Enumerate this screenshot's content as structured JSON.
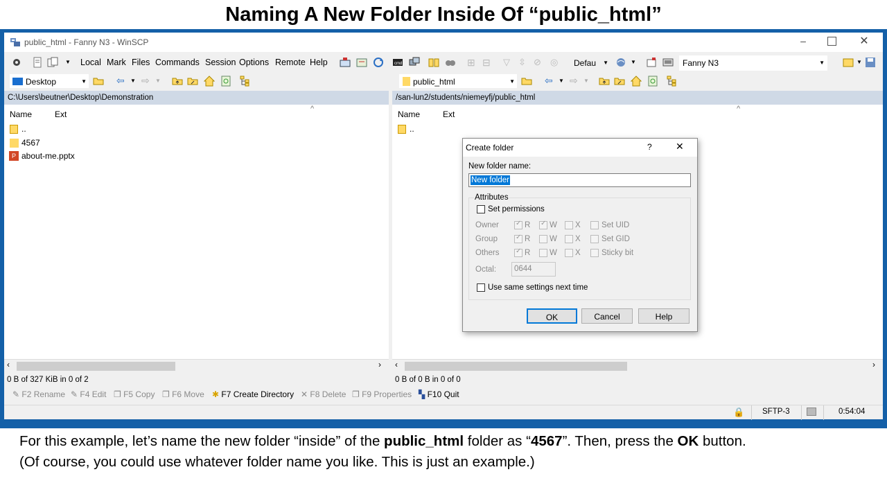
{
  "slide": {
    "title": "Naming A New Folder Inside Of “public_html”",
    "caption_1a": "For this example, let’s name the new folder “inside” of the ",
    "caption_1b": "public_html",
    "caption_1c": " folder as “",
    "caption_1d": "4567",
    "caption_1e": "”. Then, press the ",
    "caption_1f": "OK",
    "caption_1g": " button.",
    "caption_2": "(Of course, you could use whatever folder name you like. This is just an example.)"
  },
  "window": {
    "title": "public_html - Fanny N3 - WinSCP",
    "menu": [
      "Local",
      "Mark",
      "Files",
      "Commands",
      "Session",
      "Options",
      "Remote",
      "Help"
    ],
    "transfer_setting": "Defau",
    "session_name": "Fanny N3"
  },
  "left_panel": {
    "drive": "Desktop",
    "path": "C:\\Users\\beutner\\Desktop\\Demonstration",
    "col_name": "Name",
    "col_ext": "Ext",
    "files": [
      {
        "name": "..",
        "icon": "parent-folder-icon"
      },
      {
        "name": "4567",
        "icon": "folder-icon"
      },
      {
        "name": "about-me.pptx",
        "icon": "powerpoint-file-icon"
      }
    ],
    "status": "0 B of 327 KiB in 0 of 2"
  },
  "right_panel": {
    "drive": "public_html",
    "path": "/san-lun2/students/niemeyfj/public_html",
    "col_name": "Name",
    "col_ext": "Ext",
    "files": [
      {
        "name": "..",
        "icon": "parent-folder-icon"
      }
    ],
    "status": "0 B of 0 B in 0 of 0"
  },
  "fkeys": [
    "F2 Rename",
    "F4 Edit",
    "F5 Copy",
    "F6 Move",
    "F7 Create Directory",
    "F8 Delete",
    "F9 Properties",
    "F10 Quit"
  ],
  "statusbar": {
    "protocol": "SFTP-3",
    "time": "0:54:04"
  },
  "dialog": {
    "title": "Create folder",
    "help_glyph": "?",
    "close_glyph": "✕",
    "name_label": "New folder name:",
    "name_value": "New folder",
    "attributes_label": "Attributes",
    "set_permissions": "Set permissions",
    "rows": [
      {
        "label": "Owner",
        "r": true,
        "w": true,
        "x": false,
        "special": "Set UID"
      },
      {
        "label": "Group",
        "r": true,
        "w": false,
        "x": false,
        "special": "Set GID"
      },
      {
        "label": "Others",
        "r": true,
        "w": false,
        "x": false,
        "special": "Sticky bit"
      }
    ],
    "r_label": "R",
    "w_label": "W",
    "x_label": "X",
    "octal_label": "Octal:",
    "octal_value": "0644",
    "same_settings": "Use same settings next time",
    "ok": "OK",
    "cancel": "Cancel",
    "help": "Help"
  },
  "colors": {
    "frame_blue": "#1460a8",
    "path_bar": "#cfd9e6",
    "selection": "#0078d7",
    "folder_yellow": "#ffd966"
  }
}
